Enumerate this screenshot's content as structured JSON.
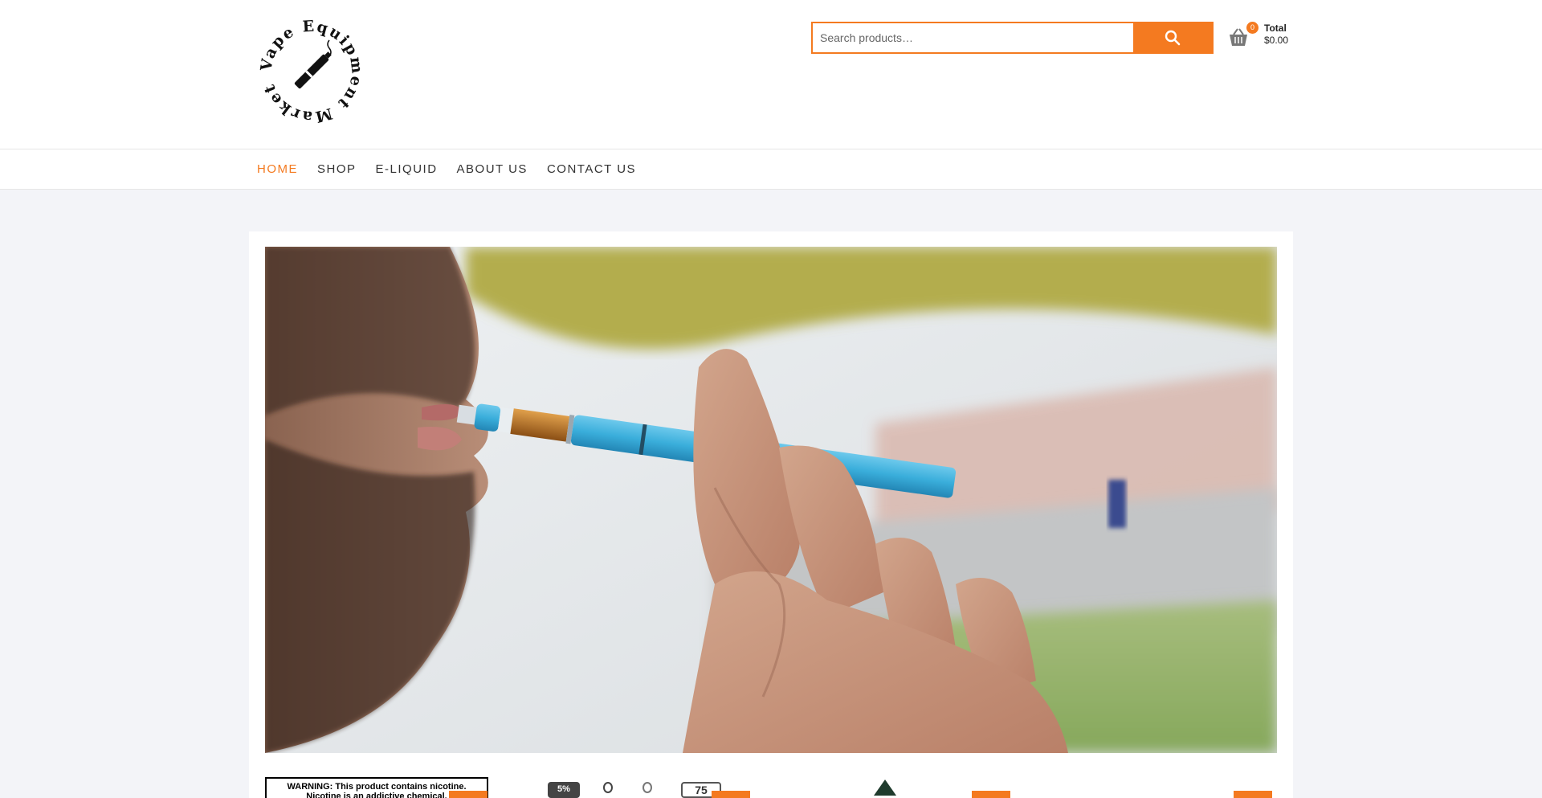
{
  "site": {
    "logo_text": "Vape Equipment Market",
    "logo_icon": "vape-pen-logo-icon"
  },
  "search": {
    "placeholder": "Search products…",
    "value": "",
    "button_icon": "search-icon"
  },
  "cart": {
    "icon": "basket-icon",
    "count": "0",
    "total_label": "Total",
    "total_value": "$0.00"
  },
  "nav": {
    "items": [
      {
        "label": "HOME",
        "active": true
      },
      {
        "label": "SHOP",
        "active": false
      },
      {
        "label": "E-LIQUID",
        "active": false
      },
      {
        "label": "ABOUT US",
        "active": false
      },
      {
        "label": "CONTACT US",
        "active": false
      }
    ]
  },
  "hero": {
    "image_subject": "man vaping a blue vape pen"
  },
  "products": {
    "warning_line1": "WARNING: This product contains nicotine.",
    "warning_line2": "Nicotine is an addictive chemical.",
    "thumb_text_1": "5%",
    "thumb_text_2": "75"
  },
  "colors": {
    "accent": "#f47a20",
    "page_bg": "#f3f4f8"
  }
}
